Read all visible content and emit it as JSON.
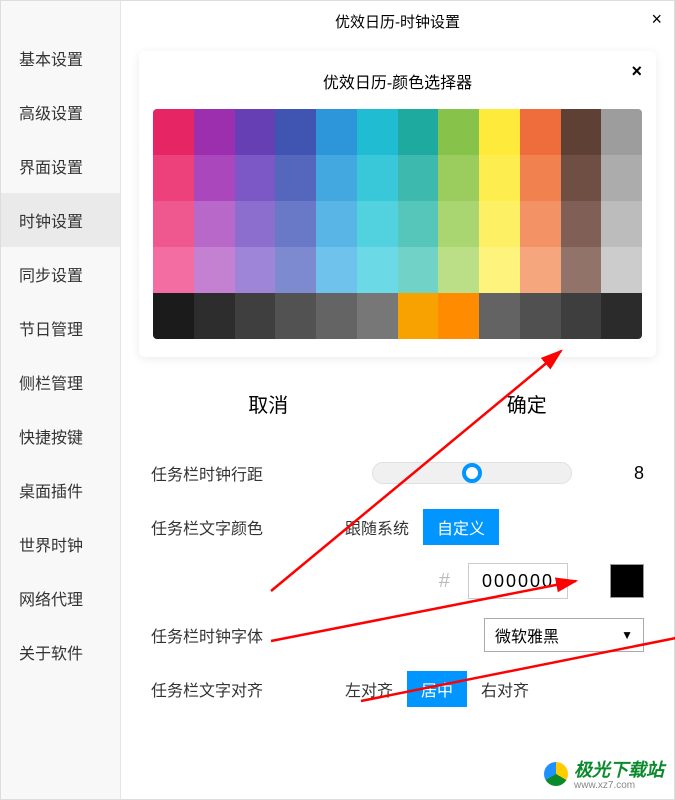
{
  "title": "优效日历-时钟设置",
  "sidebar": {
    "items": [
      {
        "label": "基本设置"
      },
      {
        "label": "高级设置"
      },
      {
        "label": "界面设置"
      },
      {
        "label": "时钟设置"
      },
      {
        "label": "同步设置"
      },
      {
        "label": "节日管理"
      },
      {
        "label": "侧栏管理"
      },
      {
        "label": "快捷按键"
      },
      {
        "label": "桌面插件"
      },
      {
        "label": "世界时钟"
      },
      {
        "label": "网络代理"
      },
      {
        "label": "关于软件"
      }
    ],
    "active_index": 3
  },
  "color_picker": {
    "title": "优效日历-颜色选择器",
    "cancel": "取消",
    "confirm": "确定",
    "grid": [
      [
        "#e62565",
        "#9b2fae",
        "#673fb4",
        "#4054b2",
        "#2d96da",
        "#1fbcd2",
        "#1eaa9e",
        "#87c34a",
        "#feea3a",
        "#ef6d3c",
        "#5e4035",
        "#9d9d9d"
      ],
      [
        "#ec417a",
        "#aa47bc",
        "#7b58c5",
        "#5566bd",
        "#43a7e0",
        "#39c8d9",
        "#3db9ad",
        "#9acd5d",
        "#feed4f",
        "#f1814f",
        "#6f4e44",
        "#acacac"
      ],
      [
        "#ef578f",
        "#b768c8",
        "#8c6ece",
        "#6978c7",
        "#58b5e6",
        "#52d1df",
        "#56c5ba",
        "#aad671",
        "#fef065",
        "#f39365",
        "#806056",
        "#bcbcbc"
      ],
      [
        "#f36da3",
        "#c481d2",
        "#9e85d7",
        "#7e8ad0",
        "#6ec2ec",
        "#6cdae6",
        "#71d2c8",
        "#bbdf87",
        "#fef37d",
        "#f5a67d",
        "#917369",
        "#cccccc"
      ],
      [
        "#1b1b1b",
        "#2d2d2d",
        "#3f3f3f",
        "#525252",
        "#646464",
        "#777777",
        "#f7a200",
        "#ff8c00",
        "#636363",
        "#505050",
        "#3e3e3e",
        "#2b2b2b"
      ]
    ]
  },
  "settings": {
    "line_spacing": {
      "label": "任务栏时钟行距",
      "value": "8"
    },
    "text_color": {
      "label": "任务栏文字颜色",
      "follow": "跟随系统",
      "custom": "自定义",
      "hex": "000000"
    },
    "font": {
      "label": "任务栏时钟字体",
      "value": "微软雅黑"
    },
    "align": {
      "label": "任务栏文字对齐",
      "left": "左对齐",
      "center": "居中",
      "right": "右对齐"
    }
  },
  "watermark": {
    "name": "极光下载站",
    "url": "www.xz7.com"
  }
}
